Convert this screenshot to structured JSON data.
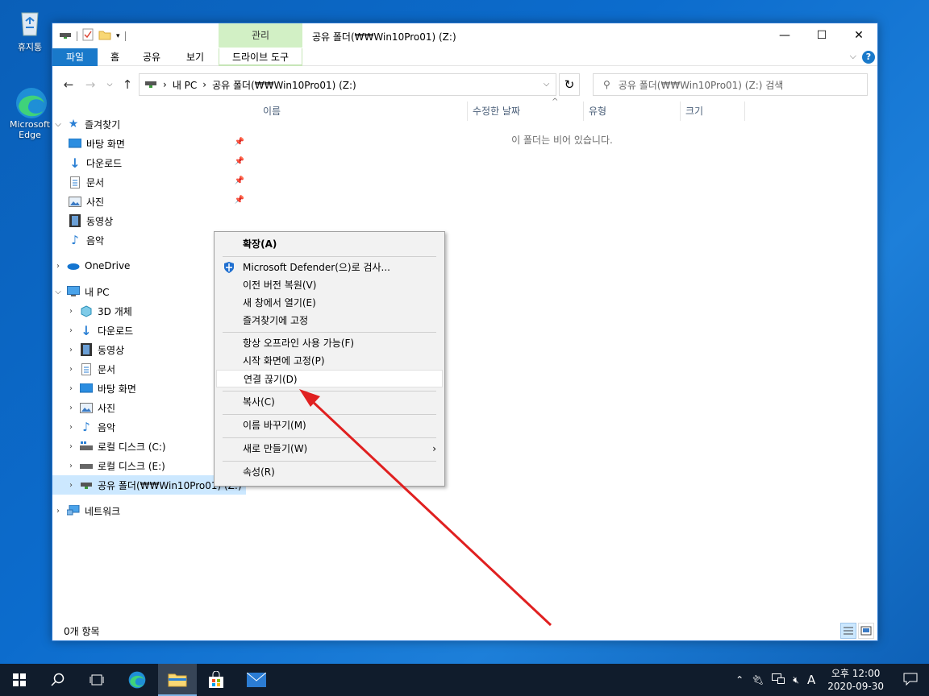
{
  "desktop": {
    "recycle_bin": "휴지통",
    "edge_line1": "Microsoft",
    "edge_line2": "Edge"
  },
  "window": {
    "title": "공유 폴더(₩₩Win10Pro01) (Z:)",
    "context_tab_header": "관리",
    "ribbon_tabs": [
      "파일",
      "홈",
      "공유",
      "보기"
    ],
    "context_tab": "드라이브 도구"
  },
  "address": {
    "path": [
      "내 PC",
      "공유 폴더(₩₩Win10Pro01) (Z:)"
    ],
    "search_placeholder": "공유 폴더(₩₩Win10Pro01) (Z:) 검색"
  },
  "nav": {
    "quick_access": "즐겨찾기",
    "qa_items": [
      "바탕 화면",
      "다운로드",
      "문서",
      "사진",
      "동영상",
      "음악"
    ],
    "onedrive": "OneDrive",
    "this_pc": "내 PC",
    "pc_items": [
      "3D 개체",
      "다운로드",
      "동영상",
      "문서",
      "바탕 화면",
      "사진",
      "음악",
      "로컬 디스크 (C:)",
      "로컬 디스크 (E:)",
      "공유 폴더(₩₩Win10Pro01) (Z:)"
    ],
    "network": "네트워크"
  },
  "columns": [
    "이름",
    "수정한 날짜",
    "유형",
    "크기"
  ],
  "empty_message": "이 폴더는 비어 있습니다.",
  "status": {
    "item_count": "0개 항목"
  },
  "context_menu": {
    "expand": "확장(A)",
    "defender": "Microsoft Defender(으)로 검사...",
    "restore": "이전 버전 복원(V)",
    "open_new": "새 창에서 열기(E)",
    "pin_quick": "즐겨찾기에 고정",
    "offline": "항상 오프라인 사용 가능(F)",
    "pin_start": "시작 화면에 고정(P)",
    "disconnect": "연결 끊기(D)",
    "copy": "복사(C)",
    "rename": "이름 바꾸기(M)",
    "new": "새로 만들기(W)",
    "properties": "속성(R)"
  },
  "taskbar": {
    "ime": "A",
    "time": "오후 12:00",
    "date": "2020-09-30"
  },
  "colors": {
    "accent": "#1979ca",
    "selection": "#cce8ff",
    "annotation_arrow": "#e02020"
  }
}
